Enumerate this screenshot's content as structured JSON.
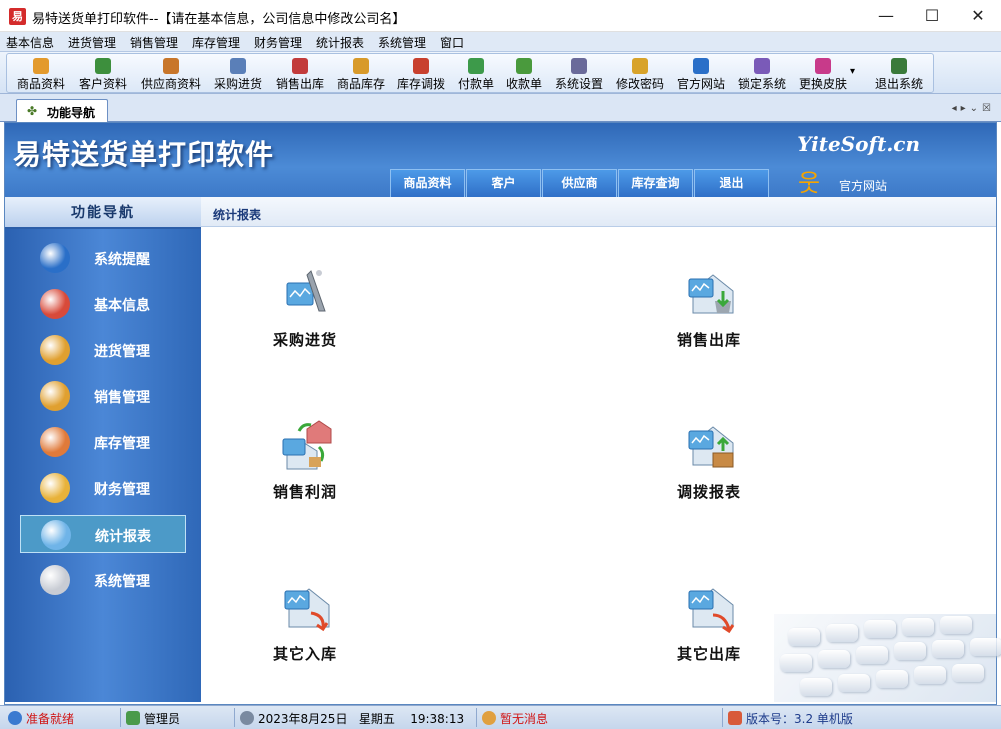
{
  "window": {
    "app_icon_char": "易",
    "title": "易特送货单打印软件--【请在基本信息，公司信息中修改公司名】",
    "minimize": "—",
    "maximize": "☐",
    "close": "✕"
  },
  "menu": [
    "基本信息",
    "进货管理",
    "销售管理",
    "库存管理",
    "财务管理",
    "统计报表",
    "系统管理",
    "窗口"
  ],
  "toolbar": {
    "items": [
      {
        "label": "商品资料",
        "icon": "package-icon",
        "color": "#e39a2d"
      },
      {
        "label": "客户资料",
        "icon": "customer-icon",
        "color": "#3d8f3d"
      },
      {
        "label": "供应商资料",
        "icon": "supplier-icon",
        "color": "#c8762a"
      },
      {
        "label": "采购进货",
        "icon": "truck-icon",
        "color": "#5a7fb8"
      },
      {
        "label": "销售出库",
        "icon": "cart-icon",
        "color": "#c23b3b"
      },
      {
        "label": "商品库存",
        "icon": "boxes-icon",
        "color": "#d89a2a"
      },
      {
        "label": "库存调拨",
        "icon": "transfer-icon",
        "color": "#c8402e"
      },
      {
        "label": "付款单",
        "icon": "payment-icon",
        "color": "#3d9a4a"
      },
      {
        "label": "收款单",
        "icon": "receipt-icon",
        "color": "#4a9a3d"
      },
      {
        "label": "系统设置",
        "icon": "settings-icon",
        "color": "#6a6a9a"
      },
      {
        "label": "修改密码",
        "icon": "key-icon",
        "color": "#d8a32a"
      },
      {
        "label": "官方网站",
        "icon": "ie-icon",
        "color": "#2a6fc8"
      },
      {
        "label": "锁定系统",
        "icon": "lock-icon",
        "color": "#7a5ab8"
      },
      {
        "label": "更换皮肤",
        "icon": "palette-icon",
        "color": "#c83a8a"
      },
      {
        "label": "退出系统",
        "icon": "exit-icon",
        "color": "#3a7a3a"
      }
    ],
    "more": "▾"
  },
  "tabs": {
    "nav_label": "功能导航",
    "nav_icon": "✤",
    "controls": "◂▸⌄☒"
  },
  "banner": {
    "title": "易特送货单打印软件",
    "brand": "YiteSoft.cn",
    "tabs": [
      "商品资料",
      "客户",
      "供应商",
      "库存查询",
      "退出"
    ],
    "site_icon": "웃",
    "site_label": "官方网站"
  },
  "sidebar": {
    "title": "功能导航",
    "items": [
      {
        "label": "系统提醒",
        "icon": "info-icon",
        "color": "#2a6fc8"
      },
      {
        "label": "基本信息",
        "icon": "cubes-icon",
        "color": "#d84a3a"
      },
      {
        "label": "进货管理",
        "icon": "import-box-icon",
        "color": "#e0a030"
      },
      {
        "label": "销售管理",
        "icon": "export-box-icon",
        "color": "#e0a030"
      },
      {
        "label": "库存管理",
        "icon": "warehouse-icon",
        "color": "#e07a3a"
      },
      {
        "label": "财务管理",
        "icon": "finance-icon",
        "color": "#e8b23a"
      },
      {
        "label": "统计报表",
        "icon": "chart-icon",
        "color": "#6fb4e8",
        "active": true
      },
      {
        "label": "系统管理",
        "icon": "gears-icon",
        "color": "#c8ccd4"
      }
    ]
  },
  "content": {
    "crumb": "统计报表",
    "tiles": [
      {
        "label": "采购进货",
        "icon": "purchase-report-icon"
      },
      {
        "label": "销售出库",
        "icon": "sales-report-icon"
      },
      {
        "label": "销售利润",
        "icon": "profit-report-icon"
      },
      {
        "label": "调拨报表",
        "icon": "transfer-report-icon"
      },
      {
        "label": "其它入库",
        "icon": "other-in-icon"
      },
      {
        "label": "其它出库",
        "icon": "other-out-icon"
      }
    ]
  },
  "status": {
    "ready": "准备就绪",
    "user": "管理员",
    "date": "2023年8月25日",
    "weekday": "星期五",
    "time": "19:38:13",
    "messages": "暂无消息",
    "version": "版本号：3.2 单机版"
  }
}
